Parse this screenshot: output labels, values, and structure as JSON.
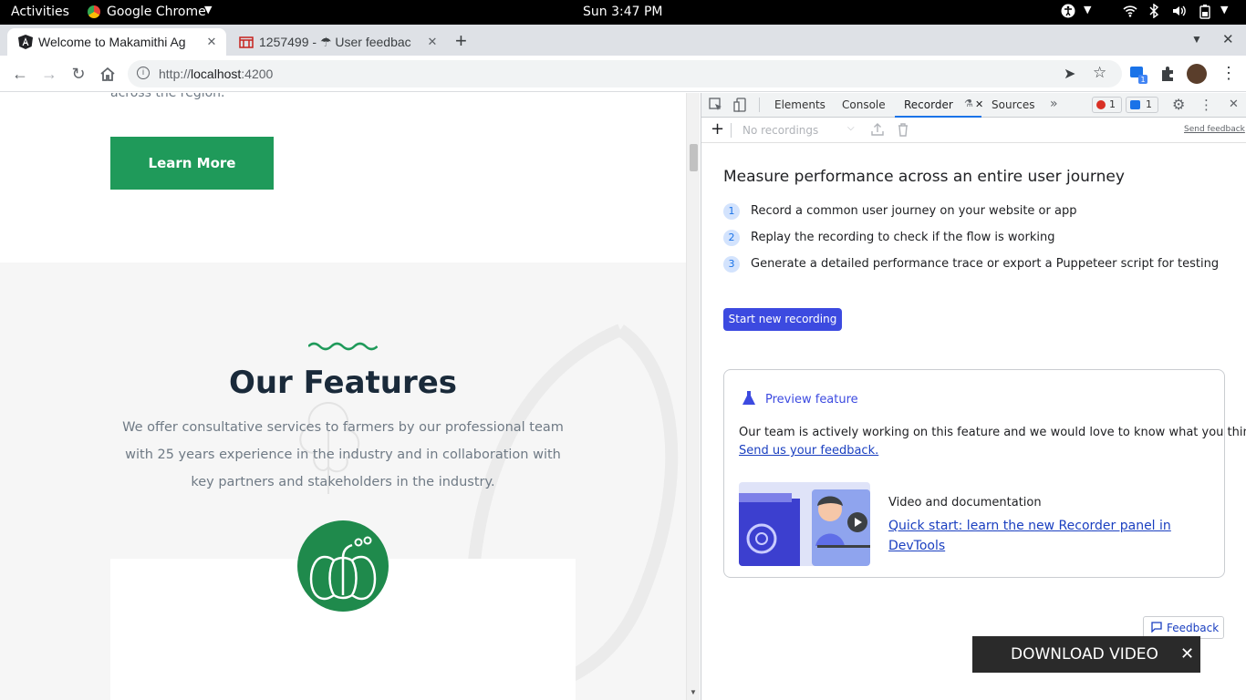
{
  "topbar": {
    "activities": "Activities",
    "app_name": "Google Chrome",
    "clock": "Sun  3:47 PM"
  },
  "tabs": [
    {
      "title": "Welcome to Makamithi Ag",
      "active": true
    },
    {
      "title": "1257499 - ☂ User feedbac",
      "active": false
    }
  ],
  "omnibox": {
    "host": "localhost",
    "rest": ":4200",
    "scheme": "http://"
  },
  "page": {
    "clipped_text": "across the region.",
    "learn_more": "Learn More",
    "features_title": "Our Features",
    "features_desc": "We offer consultative services to farmers by our professional team with 25 years experience in the industry and in collaboration with key partners and stakeholders in the industry."
  },
  "devtools": {
    "tabs": [
      "Elements",
      "Console",
      "Recorder",
      "Sources"
    ],
    "errors": "1",
    "messages": "1",
    "no_recordings": "No recordings",
    "send_feedback": "Send feedback",
    "heading": "Measure performance across an entire user journey",
    "steps": [
      {
        "num": "1",
        "text": "Record a common user journey on your website or app"
      },
      {
        "num": "2",
        "text": "Replay the recording to check if the flow is working"
      },
      {
        "num": "3",
        "text": "Generate a detailed performance trace or export a Puppeteer script for testing"
      }
    ],
    "start_button": "Start new recording",
    "preview_title": "Preview feature",
    "preview_body": "Our team is actively working on this feature and we would love to know what you think.",
    "preview_link": "Send us your feedback.",
    "video_heading": "Video and documentation",
    "video_link": "Quick start: learn the new Recorder panel in DevTools",
    "feedback_button": "Feedback"
  },
  "download": {
    "label": "DOWNLOAD VIDEO"
  },
  "colors": {
    "brand_green": "#1f9a5a",
    "devtools_accent": "#3c4ae0"
  }
}
